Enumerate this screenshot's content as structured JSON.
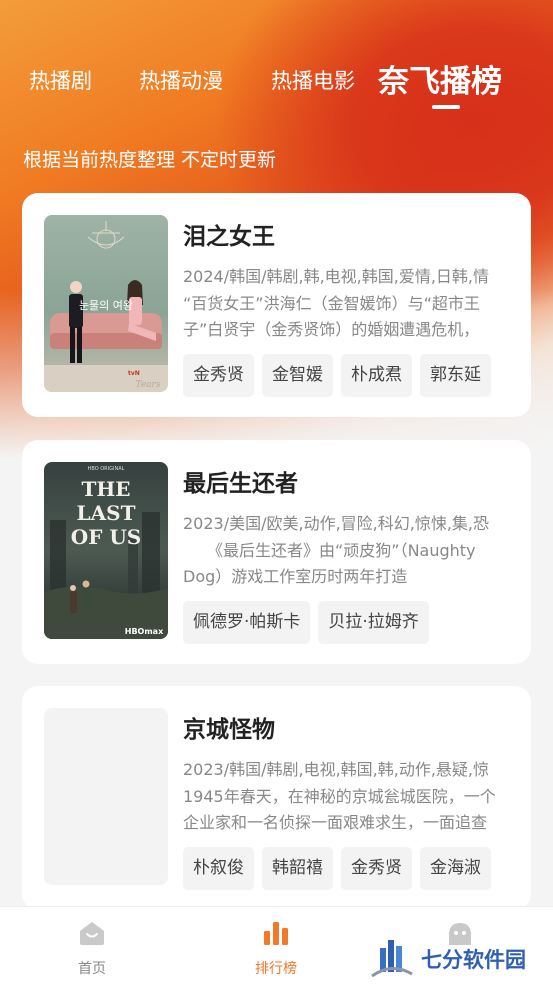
{
  "tabs": [
    {
      "label": "热播剧"
    },
    {
      "label": "热播动漫"
    },
    {
      "label": "热播电影"
    },
    {
      "label": "奈飞播榜",
      "active": true
    }
  ],
  "subtitle": "根据当前热度整理 不定时更新",
  "cards": [
    {
      "title": "泪之女王",
      "meta": "2024/韩国/韩剧,韩,电视,韩国,爱情,日韩,情",
      "desc": "“百货女王”洪海仁（金智媛饰）与“超市王子”白贤宇（金秀贤饰）的婚姻遭遇危机，",
      "tags": [
        "金秀贤",
        "金智媛",
        "朴成焄",
        "郭东延"
      ],
      "poster_text": "눈물의 여왕",
      "poster_sub": "Queen of Tears",
      "poster_brand": "tvN"
    },
    {
      "title": "最后生还者",
      "meta": "2023/美国/欧美,动作,冒险,科幻,惊悚,集,恐",
      "desc": "　　《最后生还者》由“顽皮狗”（Naughty Dog）游戏工作室历时两年打造",
      "tags": [
        "佩德罗·帕斯卡",
        "贝拉·拉姆齐"
      ],
      "poster_top": "HBO ORIGINAL",
      "poster_text": "THE LAST OF US",
      "poster_brand": "HBOmax"
    },
    {
      "title": "京城怪物",
      "meta": "2023/韩国/韩剧,电视,韩国,韩,动作,悬疑,惊",
      "desc": "1945年春天，在神秘的京城瓮城医院，一个企业家和一名侦探一面艰难求生，一面追查",
      "tags": [
        "朴叙俊",
        "韩韶禧",
        "金秀贤",
        "金海淑"
      ]
    }
  ],
  "bottom_nav": [
    {
      "label": "首页",
      "icon": "home-icon"
    },
    {
      "label": "排行榜",
      "icon": "ranking-icon",
      "active": true
    },
    {
      "label": "",
      "icon": "profile-icon"
    }
  ],
  "watermark": "七分软件园",
  "colors": {
    "accent": "#f07a2a",
    "hero": "#e2521c"
  }
}
